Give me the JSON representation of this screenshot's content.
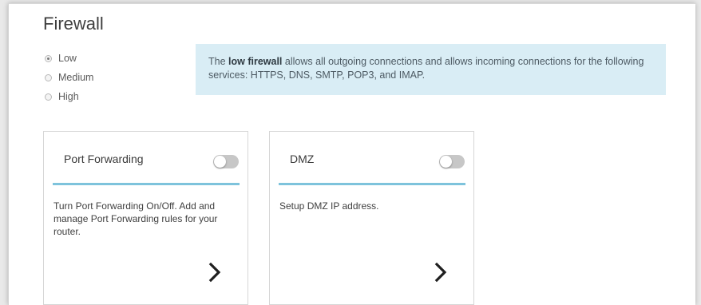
{
  "page": {
    "title": "Firewall"
  },
  "firewall_levels": [
    {
      "label": "Low",
      "checked": true
    },
    {
      "label": "Medium",
      "checked": false
    },
    {
      "label": "High",
      "checked": false
    }
  ],
  "info": {
    "prefix": "The ",
    "bold": "low firewall",
    "suffix": " allows all outgoing connections and allows incoming connections for the following services: HTTPS, DNS, SMTP, POP3, and IMAP."
  },
  "cards": [
    {
      "title": "Port Forwarding",
      "toggle_on": false,
      "description": "Turn Port Forwarding On/Off. Add and manage Port Forwarding rules for your router.",
      "icon": "chevron-right-icon"
    },
    {
      "title": "DMZ",
      "toggle_on": false,
      "description": "Setup DMZ IP address.",
      "icon": "chevron-right-icon"
    }
  ],
  "colors": {
    "info_background": "#d9edf5",
    "card_rule": "#7ec3dc",
    "toggle_off": "#c7c7c7"
  }
}
